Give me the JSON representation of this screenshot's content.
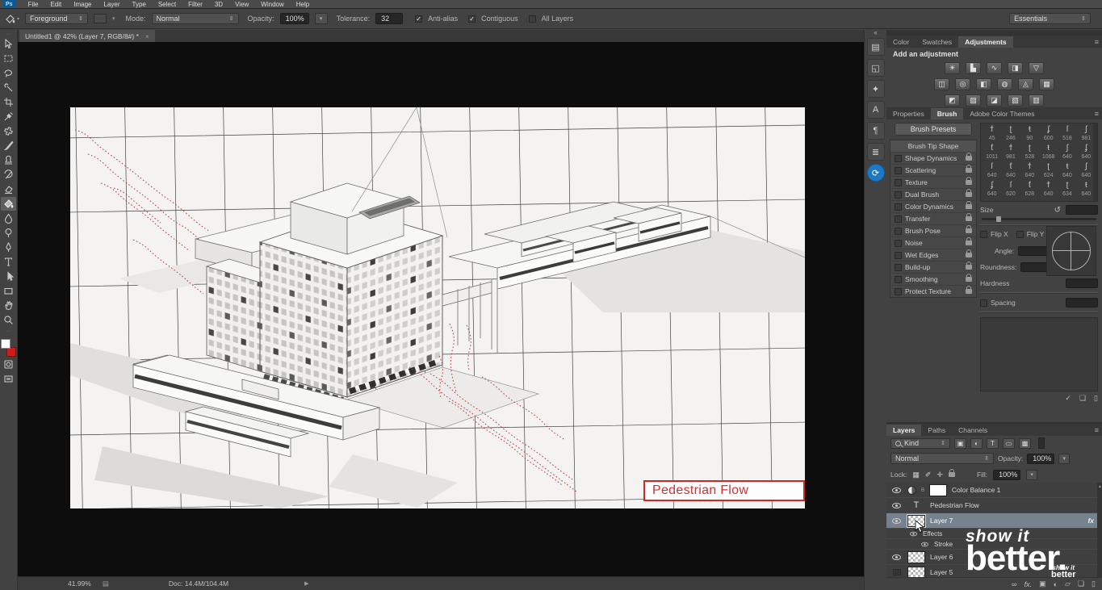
{
  "app": {
    "logo": "Ps",
    "workspace": "Essentials"
  },
  "menu": {
    "items": [
      "File",
      "Edit",
      "Image",
      "Layer",
      "Type",
      "Select",
      "Filter",
      "3D",
      "View",
      "Window",
      "Help"
    ]
  },
  "options": {
    "fill_source": "Foreground",
    "mode_label": "Mode:",
    "mode_value": "Normal",
    "opacity_label": "Opacity:",
    "opacity_value": "100%",
    "tolerance_label": "Tolerance:",
    "tolerance_value": "32",
    "anti_alias": "Anti-alias",
    "contiguous": "Contiguous",
    "all_layers": "All Layers"
  },
  "document": {
    "tab_title": "Untitled1 @ 42% (Layer 7, RGB/8#) *",
    "close_glyph": "×",
    "zoom_level": "41.99%",
    "doc_info": "Doc: 14.4M/104.4M"
  },
  "canvas": {
    "flow_label": "Pedestrian Flow"
  },
  "panels": {
    "adjustments": {
      "tabs": [
        "Color",
        "Swatches",
        "Adjustments"
      ],
      "heading": "Add an adjustment"
    },
    "brush": {
      "tabs": [
        "Properties",
        "Brush",
        "Adobe Color Themes"
      ],
      "presets_button": "Brush Presets",
      "tip_shape": "Brush Tip Shape",
      "options": [
        "Shape Dynamics",
        "Scattering",
        "Texture",
        "Dual Brush",
        "Color Dynamics",
        "Transfer",
        "Brush Pose",
        "Noise",
        "Wet Edges",
        "Build-up",
        "Smoothing",
        "Protect Texture"
      ],
      "sizes": [
        "45",
        "246",
        "90",
        "600",
        "518",
        "981",
        "1011",
        "981",
        "528",
        "1068",
        "640",
        "640",
        "640",
        "640",
        "640",
        "624",
        "640",
        "640",
        "640",
        "620",
        "628",
        "640",
        "634",
        "640"
      ],
      "size_label": "Size",
      "flip_x": "Flip X",
      "flip_y": "Flip Y",
      "angle_label": "Angle:",
      "roundness_label": "Roundness:",
      "hardness_label": "Hardness",
      "spacing_label": "Spacing"
    },
    "layers": {
      "tabs": [
        "Layers",
        "Paths",
        "Channels"
      ],
      "filter_label": "Kind",
      "blend_mode": "Normal",
      "opacity_label": "Opacity:",
      "opacity_value": "100%",
      "lock_label": "Lock:",
      "fill_label": "Fill:",
      "fill_value": "100%",
      "rows": [
        {
          "name": "Color Balance 1"
        },
        {
          "name": "Pedestrian Flow"
        },
        {
          "name": "Layer 7",
          "fx": "fx"
        },
        {
          "name": "Effects"
        },
        {
          "name": "Stroke"
        },
        {
          "name": "Layer 6"
        },
        {
          "name": "Layer 5"
        }
      ]
    }
  },
  "watermark": {
    "line1": "show it",
    "line2": "better.",
    "small1": "show it",
    "small2": "better"
  },
  "colors": {
    "accent_red": "#cf2626",
    "selection_blue": "#77828f",
    "cc_blue": "#1d79c4"
  },
  "icons": {
    "combo": "▾",
    "stepper": "⇕",
    "collapse": "«",
    "panel_menu": "≡",
    "status_doc": "▤",
    "status_play": "▶",
    "reset": "↺",
    "dock": [
      "▤",
      "◱",
      "✦",
      "A",
      "¶",
      "≣",
      "⟳"
    ],
    "adj": [
      "☀",
      "▙",
      "∿",
      "◨",
      "▽",
      "◫",
      "◎",
      "◧",
      "◍",
      "◬",
      "▦",
      "◩",
      "▨",
      "◪",
      "▧",
      "▥"
    ],
    "thumbs": [
      "ϯ",
      "ʈ",
      "ŧ",
      "ʄ",
      "ſ",
      "ʃ",
      "ƭ",
      "ϯ",
      "ʈ",
      "ŧ",
      "ʃ",
      "ʄ",
      "ſ",
      "ƭ",
      "ϯ",
      "ʈ",
      "ŧ",
      "ʃ",
      "ʄ",
      "ſ",
      "ƭ",
      "ϯ",
      "ʈ",
      "ŧ"
    ],
    "filter_row": [
      "▣",
      "◐",
      "T",
      "▭",
      "▩"
    ],
    "lock_row": [
      "▦",
      "✐",
      "✛"
    ],
    "text_layer": "T",
    "layer_footer": [
      "∞",
      "fx.",
      "▣",
      "◐",
      "▱",
      "❑",
      "▯"
    ],
    "brush_footer": [
      "✓",
      "❏",
      "▯"
    ]
  }
}
